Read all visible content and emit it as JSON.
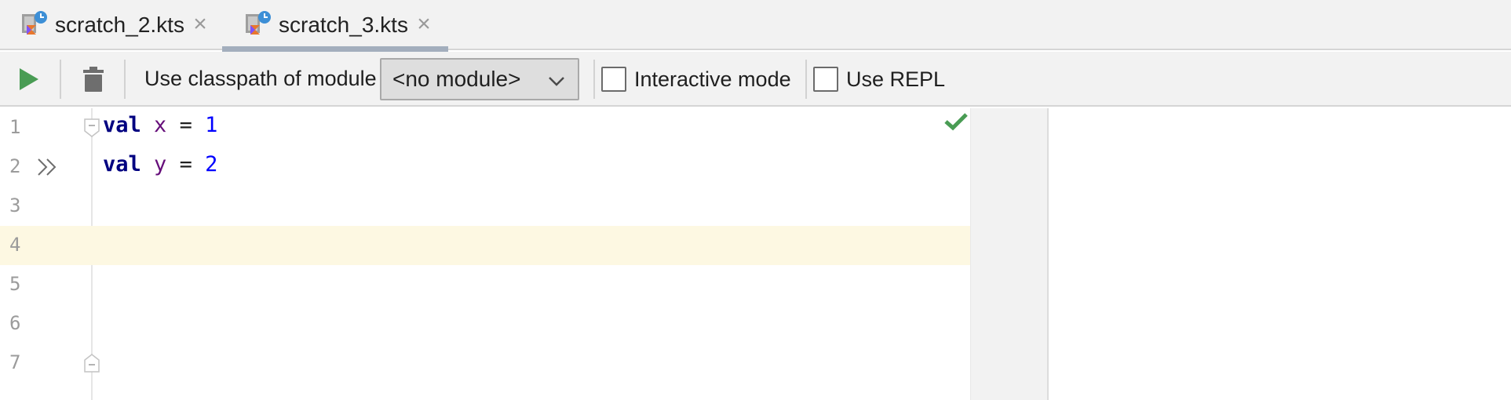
{
  "tabs": [
    {
      "label": "scratch_2.kts",
      "active": false,
      "icon": "kotlin-scratch-icon"
    },
    {
      "label": "scratch_3.kts",
      "active": true,
      "icon": "kotlin-scratch-icon"
    }
  ],
  "close_glyph": "×",
  "toolbar": {
    "module_label": "Use classpath of module",
    "module_value": "<no module>",
    "interactive_label": "Interactive mode",
    "repl_label": "Use REPL",
    "interactive_checked": false,
    "repl_checked": false
  },
  "editor": {
    "line_numbers": [
      "1",
      "2",
      "3",
      "4",
      "5",
      "6",
      "7"
    ],
    "lines": [
      {
        "kw": "val",
        "name": "x",
        "op": "=",
        "value": "1"
      },
      {
        "kw": "val",
        "name": "y",
        "op": "=",
        "value": "2"
      }
    ],
    "caret_line": 4
  },
  "colors": {
    "run": "#499c54",
    "keyword": "#000080",
    "identifier": "#660e7a",
    "number": "#0000ff",
    "caret_row": "#fdf8e2",
    "ok": "#499c54"
  }
}
